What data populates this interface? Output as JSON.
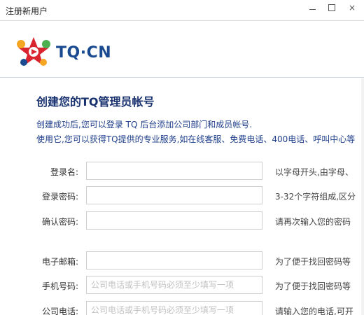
{
  "window": {
    "title": "注册新用户",
    "close_glyph": "×"
  },
  "header": {
    "logo_text": "TQ·CN"
  },
  "main": {
    "heading": "创建您的TQ管理员帐号",
    "description_line1": "创建成功后,您可以登录 TQ 后台添加公司部门和成员帐号.",
    "description_line2": "使用它,您可以获得TQ提供的专业服务,如在线客服、免费电话、400电话、呼叫中心等"
  },
  "form": {
    "fields": [
      {
        "label": "登录名:",
        "value": "",
        "placeholder": "",
        "hint": "以字母开头,由字母、"
      },
      {
        "label": "登录密码:",
        "value": "",
        "placeholder": "",
        "hint": "3-32个字符组成,区分"
      },
      {
        "label": "确认密码:",
        "value": "",
        "placeholder": "",
        "hint": "请再次输入您的密码"
      },
      {
        "label": "电子邮箱:",
        "value": "",
        "placeholder": "",
        "hint": "为了便于找回密码等"
      },
      {
        "label": "手机号码:",
        "value": "",
        "placeholder": "公司电话或手机号码必须至少填写一项",
        "hint": "为了便于找回密码等"
      },
      {
        "label": "公司电话:",
        "value": "",
        "placeholder": "公司电话或手机号码必须至少填写一项",
        "hint": "请输入您的电话,可开"
      }
    ]
  },
  "colors": {
    "heading": "#17306e",
    "description": "#1f3f8c",
    "logo_blue": "#1a4a8f",
    "logo_red": "#d9232e",
    "logo_yellow": "#f5a623",
    "logo_green": "#4caf50"
  }
}
